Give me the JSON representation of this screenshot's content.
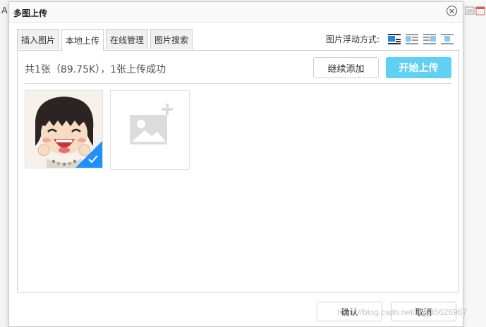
{
  "background_app": {
    "left_glyph": "A"
  },
  "dialog": {
    "title": "多图上传",
    "close_symbol": "×"
  },
  "tabs": [
    {
      "label": "插入图片",
      "active": false
    },
    {
      "label": "本地上传",
      "active": true
    },
    {
      "label": "在线管理",
      "active": false
    },
    {
      "label": "图片搜索",
      "active": false
    }
  ],
  "float_options": {
    "label": "图片浮动方式:",
    "options": [
      "align-none-icon",
      "align-left-icon",
      "align-right-icon",
      "align-center-icon"
    ],
    "selected": "align-none-icon"
  },
  "upload": {
    "status": "共1张（89.75K），1张上传成功",
    "continue_label": "继续添加",
    "start_label": "开始上传"
  },
  "footer": {
    "ok_label": "确认",
    "cancel_label": "取消"
  },
  "watermark": "https://blog.csdn.net/qq_35626967",
  "colors": {
    "accent": "#60d0f3",
    "check": "#1e90ff",
    "selected_icon": "#1e88e5"
  }
}
